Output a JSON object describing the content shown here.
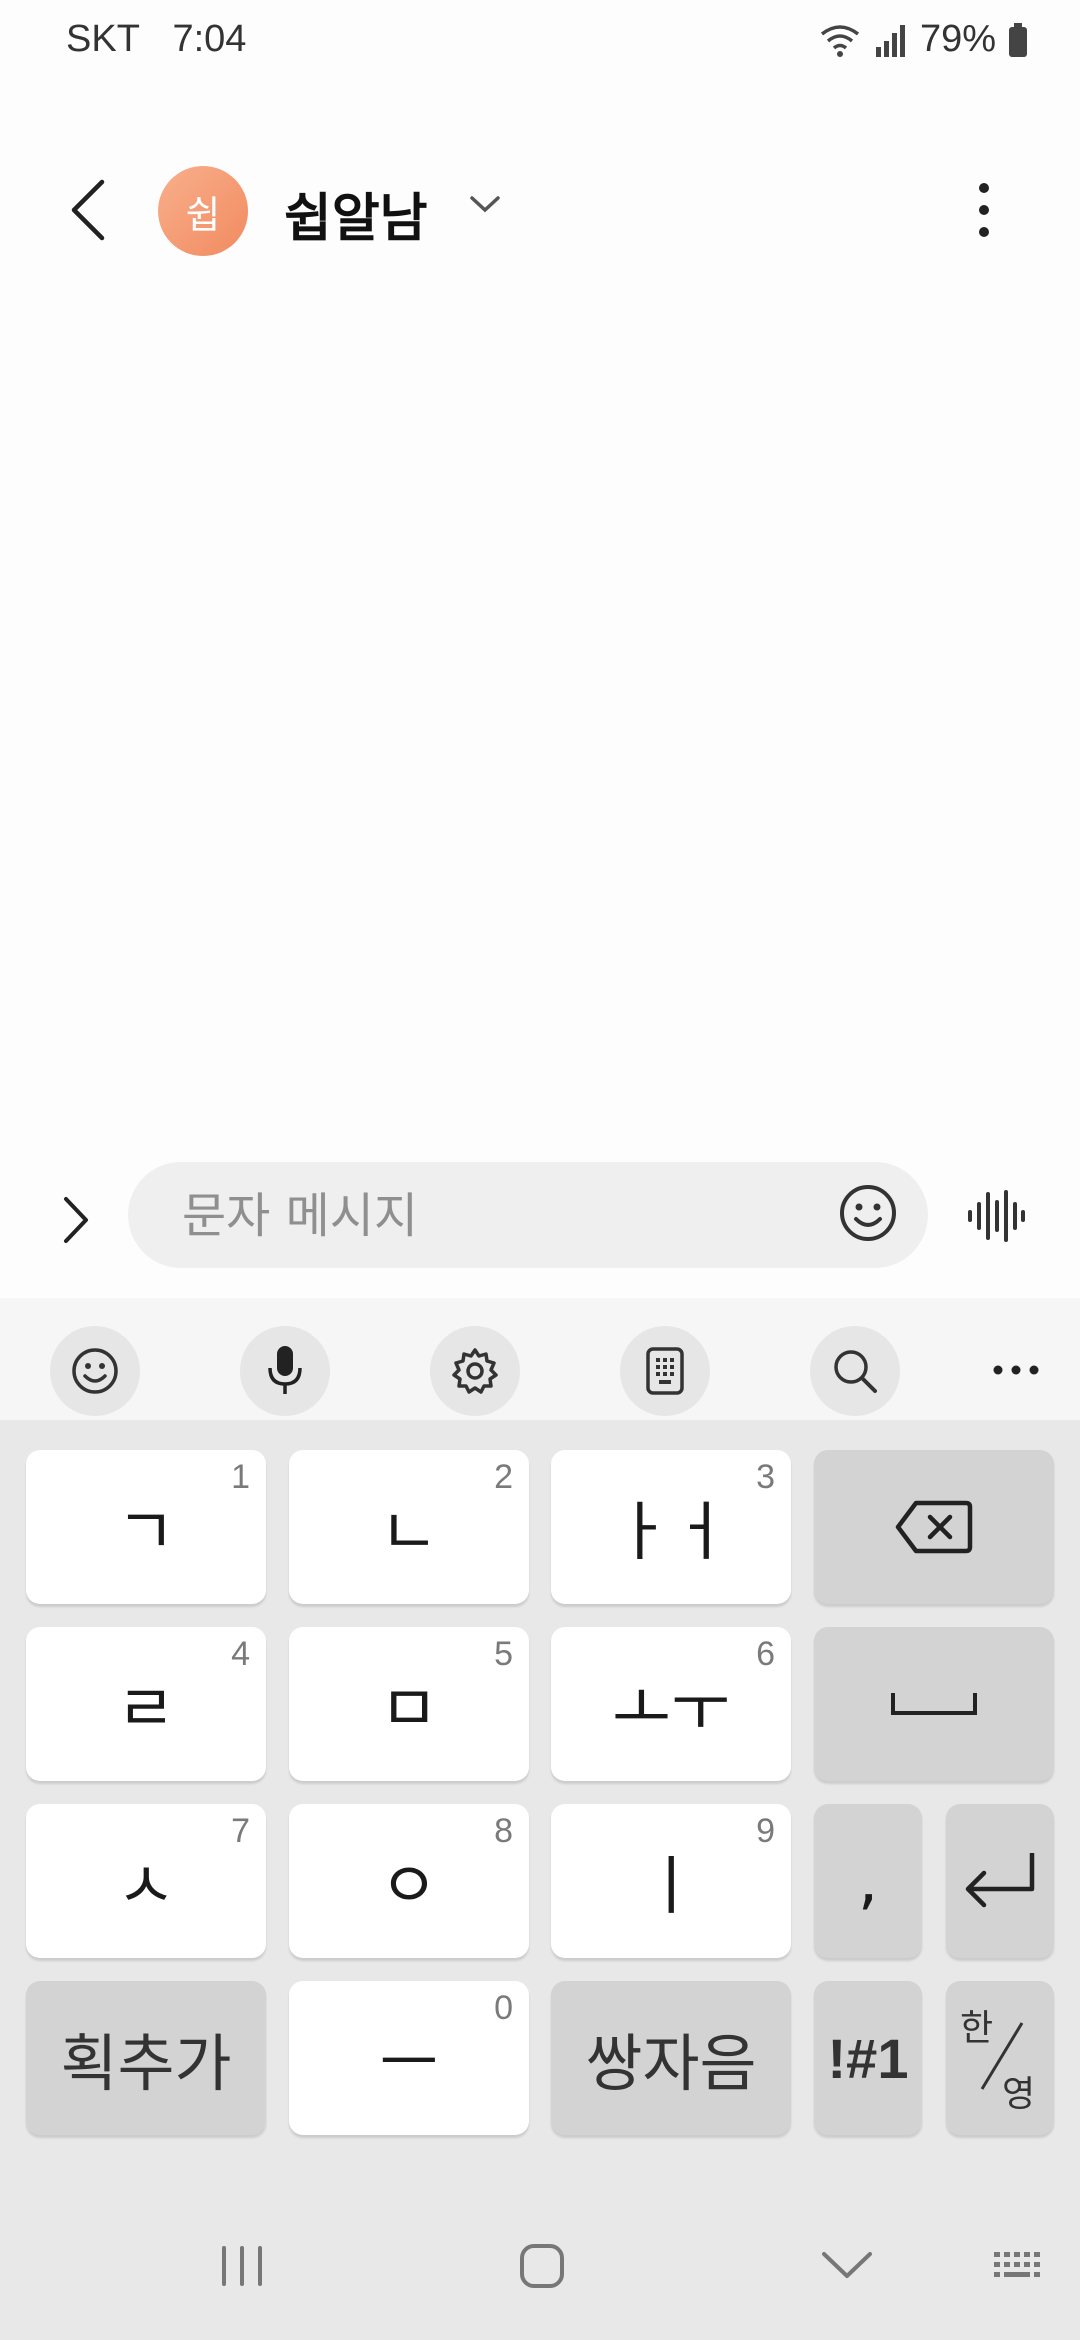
{
  "status_bar": {
    "carrier": "SKT",
    "time": "7:04",
    "battery": "79%"
  },
  "header": {
    "avatar_initial": "쉽",
    "title": "쉽알남"
  },
  "composer": {
    "placeholder": "문자 메시지"
  },
  "keyboard": {
    "keys": [
      {
        "label": "ㄱ",
        "num": "1"
      },
      {
        "label": "ㄴ",
        "num": "2"
      },
      {
        "label": "ㅏㅓ",
        "num": "3"
      },
      {
        "label": "ㄹ",
        "num": "4"
      },
      {
        "label": "ㅁ",
        "num": "5"
      },
      {
        "label": "ㅗㅜ",
        "num": "6"
      },
      {
        "label": "ㅅ",
        "num": "7"
      },
      {
        "label": "ㅇ",
        "num": "8"
      },
      {
        "label": "ㅣ",
        "num": "9"
      },
      {
        "label": "ㅡ",
        "num": "0"
      }
    ],
    "stroke_key": "획추가",
    "double_consonant_key": "쌍자음",
    "comma_key": ",",
    "symbols_key": "!#1",
    "lang_key_top": "한",
    "lang_key_bottom": "영"
  },
  "icons": {
    "toolbar": [
      "emoji-icon",
      "microphone-icon",
      "settings-icon",
      "keypad-icon",
      "search-icon",
      "more-icon"
    ],
    "nav": [
      "recent-apps-icon",
      "home-icon",
      "hide-keyboard-icon",
      "keyboard-icon"
    ]
  }
}
